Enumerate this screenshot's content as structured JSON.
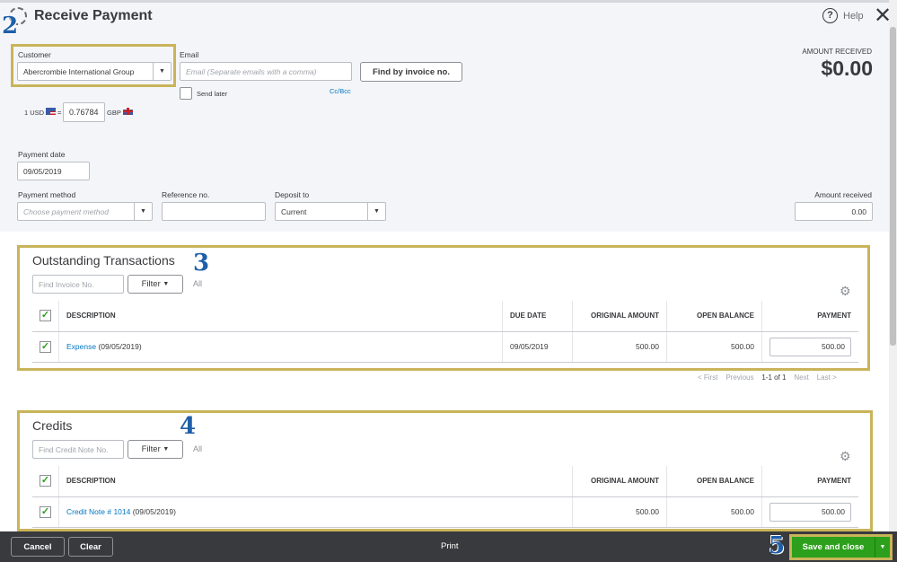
{
  "header": {
    "title": "Receive Payment",
    "help": "Help"
  },
  "customer": {
    "label": "Customer",
    "value": "Abercrombie International Group"
  },
  "email": {
    "label": "Email",
    "placeholder": "Email (Separate emails with a comma)",
    "send_later": "Send later",
    "cc_bcc": "Cc/Bcc"
  },
  "find_invoice": "Find by invoice no.",
  "amount_received": {
    "label": "AMOUNT RECEIVED",
    "value": "$0.00"
  },
  "exchange": {
    "from": "1 USD",
    "equals": "=",
    "rate": "0.76784",
    "to": "GBP"
  },
  "payment_date": {
    "label": "Payment date",
    "value": "09/05/2019"
  },
  "payment_method": {
    "label": "Payment method",
    "placeholder": "Choose payment method"
  },
  "reference": {
    "label": "Reference no.",
    "value": ""
  },
  "deposit_to": {
    "label": "Deposit to",
    "value": "Current"
  },
  "amount_received_field": {
    "label": "Amount received",
    "value": "0.00"
  },
  "outstanding": {
    "title": "Outstanding Transactions",
    "find_placeholder": "Find Invoice No.",
    "filter": "Filter",
    "all": "All",
    "columns": [
      "DESCRIPTION",
      "DUE DATE",
      "ORIGINAL AMOUNT",
      "OPEN BALANCE",
      "PAYMENT"
    ],
    "rows": [
      {
        "link": "Expense",
        "desc": " (09/05/2019)",
        "due": "09/05/2019",
        "original": "500.00",
        "open": "500.00",
        "payment": "500.00"
      }
    ],
    "pager": {
      "first": "< First",
      "previous": "Previous",
      "range": "1-1 of 1",
      "next": "Next",
      "last": "Last >"
    }
  },
  "credits": {
    "title": "Credits",
    "find_placeholder": "Find Credit Note No.",
    "filter": "Filter",
    "all": "All",
    "columns": [
      "DESCRIPTION",
      "ORIGINAL AMOUNT",
      "OPEN BALANCE",
      "PAYMENT"
    ],
    "rows": [
      {
        "link": "Credit Note # 1014",
        "desc": " (09/05/2019)",
        "original": "500.00",
        "open": "500.00",
        "payment": "500.00"
      }
    ]
  },
  "footer": {
    "cancel": "Cancel",
    "clear": "Clear",
    "print": "Print",
    "save": "Save and close"
  },
  "annotations": [
    "2",
    "3",
    "4",
    "5"
  ],
  "colors": {
    "accent_green": "#2ca01c",
    "link": "#0077c5",
    "highlight": "#c9b45a",
    "footer": "#393a3d"
  }
}
